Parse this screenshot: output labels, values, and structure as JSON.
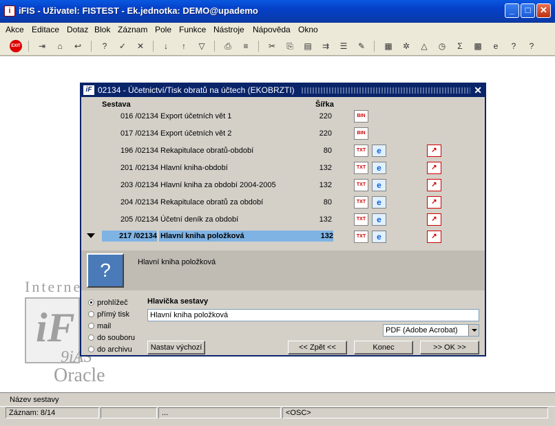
{
  "window": {
    "title": "iFIS - Uživatel: FISTEST - Ek.jednotka: DEMO@upademo"
  },
  "menu": [
    "Akce",
    "Editace",
    "Dotaz",
    "Blok",
    "Záznam",
    "Pole",
    "Funkce",
    "Nástroje",
    "Nápověda",
    "Okno"
  ],
  "background": {
    "line1": "Interne",
    "line2": "9iAS",
    "line3": "Oracle"
  },
  "dialog": {
    "title": "02134 - Účetnictví/Tisk obratů na účtech (EKOBRZTI)",
    "col_sestava": "Sestava",
    "col_sirka": "Šířka",
    "rows": [
      {
        "num": "016 /02134",
        "name": "Export účetních vět 1",
        "width": "220",
        "type": "bin"
      },
      {
        "num": "017 /02134",
        "name": "Export účetních vět 2",
        "width": "220",
        "type": "bin"
      },
      {
        "num": "196 /02134",
        "name": "Rekapitulace obratů-období",
        "width": "80",
        "type": "txt"
      },
      {
        "num": "201 /02134",
        "name": "Hlavní kniha-období",
        "width": "132",
        "type": "txt"
      },
      {
        "num": "203 /02134",
        "name": "Hlavní kniha za období 2004-2005",
        "width": "132",
        "type": "txt"
      },
      {
        "num": "204 /02134",
        "name": "Rekapitulace obratů za období",
        "width": "80",
        "type": "txt"
      },
      {
        "num": "205 /02134",
        "name": "Účetní deník za období",
        "width": "132",
        "type": "txt"
      },
      {
        "num": "217 /02134",
        "name": "Hlavní kniha položková",
        "width": "132",
        "type": "txt"
      }
    ],
    "icons": {
      "bin": "BIN",
      "txt": "TXT",
      "ie": "e",
      "pdf": "↗"
    },
    "info_text": "Hlavní kniha položková",
    "radios": [
      "prohlížeč",
      "přímý tisk",
      "mail",
      "do souboru",
      "do archivu"
    ],
    "header_label": "Hlavička sestavy",
    "header_value": "Hlavní kniha položková",
    "format_value": "PDF (Adobe Acrobat)",
    "btn_default": "Nastav výchozí",
    "btn_back": "<< Zpět <<",
    "btn_end": "Konec",
    "btn_ok": ">> OK >>"
  },
  "status": {
    "line1": "Název sestavy",
    "record": "Záznam: 8/14",
    "dots": "...",
    "osc": "<OSC>"
  }
}
